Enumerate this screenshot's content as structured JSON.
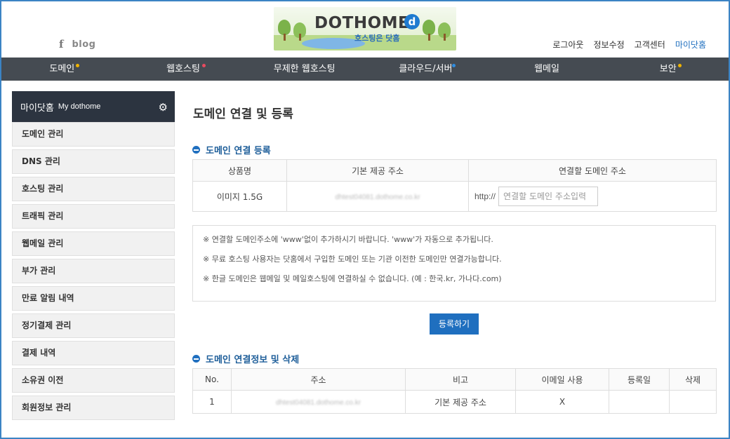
{
  "header": {
    "social": {
      "facebook_icon": "f",
      "blog_label": "blog"
    },
    "logo": {
      "brand": "DOTHOME",
      "badge": "d",
      "slogan": "호스팅은 닷홈"
    },
    "util_links": [
      "로그아웃",
      "정보수정",
      "고객센터",
      "마이닷홈"
    ]
  },
  "gnb": {
    "items": [
      {
        "label": "도메인",
        "dot_color": "#f0b400"
      },
      {
        "label": "웹호스팅",
        "dot_color": "#e84a5f"
      },
      {
        "label": "무제한 웹호스팅",
        "dot_color": ""
      },
      {
        "label": "클라우드/서버",
        "dot_color": "#2f8de0"
      },
      {
        "label": "웹메일",
        "dot_color": ""
      },
      {
        "label": "보안",
        "dot_color": "#f0b400"
      }
    ]
  },
  "sidebar": {
    "title": "마이닷홈",
    "subtitle": "My dothome",
    "settings_icon": "gear-icon",
    "items": [
      "도메인 관리",
      "DNS 관리",
      "호스팅 관리",
      "트래픽 관리",
      "웹메일 관리",
      "부가 관리",
      "만료 알림 내역",
      "정기결제 관리",
      "결제 내역",
      "소유권 이전",
      "회원정보 관리"
    ]
  },
  "main": {
    "page_title": "도메인 연결 및 등록",
    "register_section": {
      "title": "도메인 연결 등록",
      "headers": [
        "상품명",
        "기본 제공 주소",
        "연결할 도메인 주소"
      ],
      "row": {
        "product": "이미지 1.5G",
        "default_address": "dhtest04081.dothome.co.kr",
        "url_prefix": "http://",
        "domain_placeholder": "연결할 도메인 주소입력"
      }
    },
    "notices": [
      "※ 연결할 도메인주소에 'www'없이 추가하시기 바랍니다. 'www'가 자동으로 추가됩니다.",
      "※ 무료 호스팅 사용자는 닷홈에서 구입한 도메인 또는 기관 이전한 도메인만 연결가능합니다.",
      "※ 한글 도메인은 웹메일 및 메일호스팅에 연결하실 수 없습니다. (예 : 한국.kr, 가나다.com)"
    ],
    "register_button": "등록하기",
    "info_section": {
      "title": "도메인 연결정보 및 삭제",
      "headers": [
        "No.",
        "주소",
        "비고",
        "이메일 사용",
        "등록일",
        "삭제"
      ],
      "rows": [
        {
          "no": "1",
          "address": "dhtest04081.dothome.co.kr",
          "note": "기본 제공 주소",
          "email": "X",
          "registered": "",
          "delete": ""
        }
      ]
    }
  }
}
